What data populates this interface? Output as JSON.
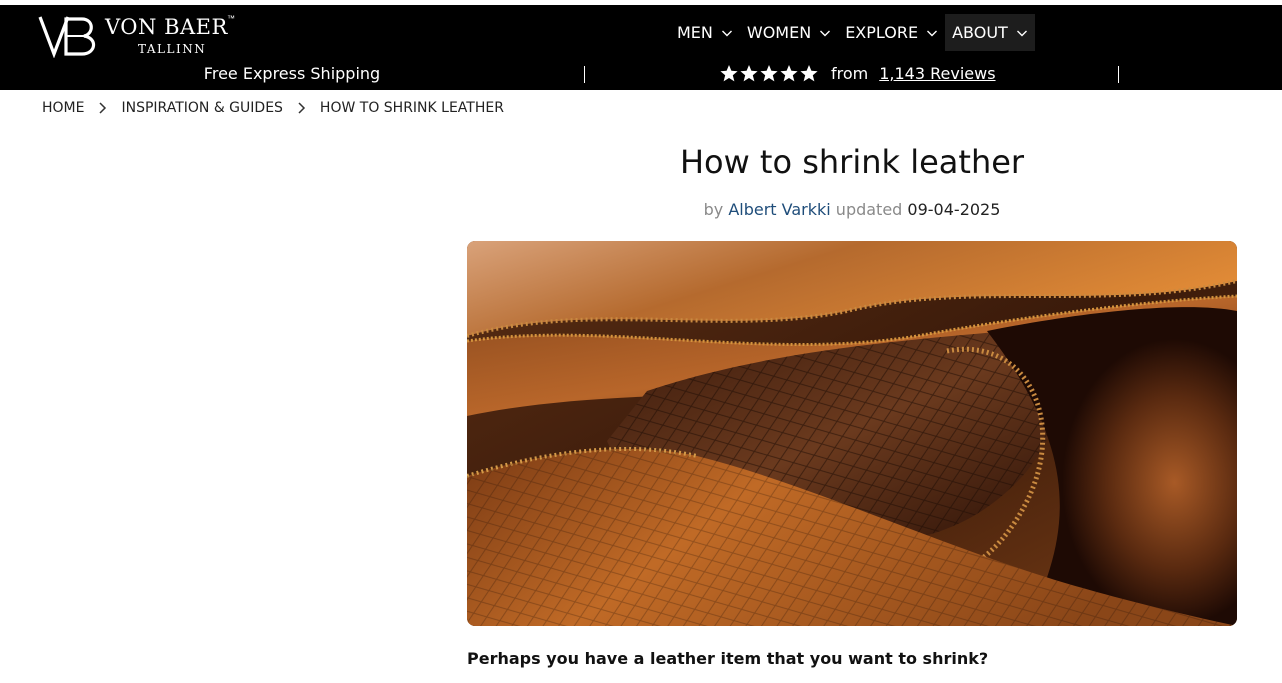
{
  "brand": {
    "monogram": "VB",
    "name": "VON BAER",
    "trademark": "™",
    "city": "TALLINN"
  },
  "nav": {
    "items": [
      {
        "label": "MEN",
        "icon": "chevron-down-icon"
      },
      {
        "label": "WOMEN",
        "icon": "chevron-down-icon"
      },
      {
        "label": "EXPLORE",
        "icon": "chevron-down-icon"
      },
      {
        "label": "ABOUT",
        "icon": "chevron-down-icon",
        "active": true
      }
    ]
  },
  "promo": {
    "shipping": "Free Express Shipping",
    "rating_stars": 5,
    "rating_prefix": "from",
    "reviews_link": "1,143 Reviews"
  },
  "breadcrumb": {
    "items": [
      "HOME",
      "INSPIRATION & GUIDES",
      "HOW TO SHRINK LEATHER"
    ]
  },
  "article": {
    "title": "How to shrink leather",
    "by": "by",
    "author": "Albert Varkki",
    "updated": "updated",
    "date": "09-04-2025",
    "intro": "Perhaps you have a leather item that you want to shrink?"
  },
  "colors": {
    "header_bg": "#000000",
    "author_link": "#1f4d7a",
    "muted_text": "#8a8a8a"
  }
}
